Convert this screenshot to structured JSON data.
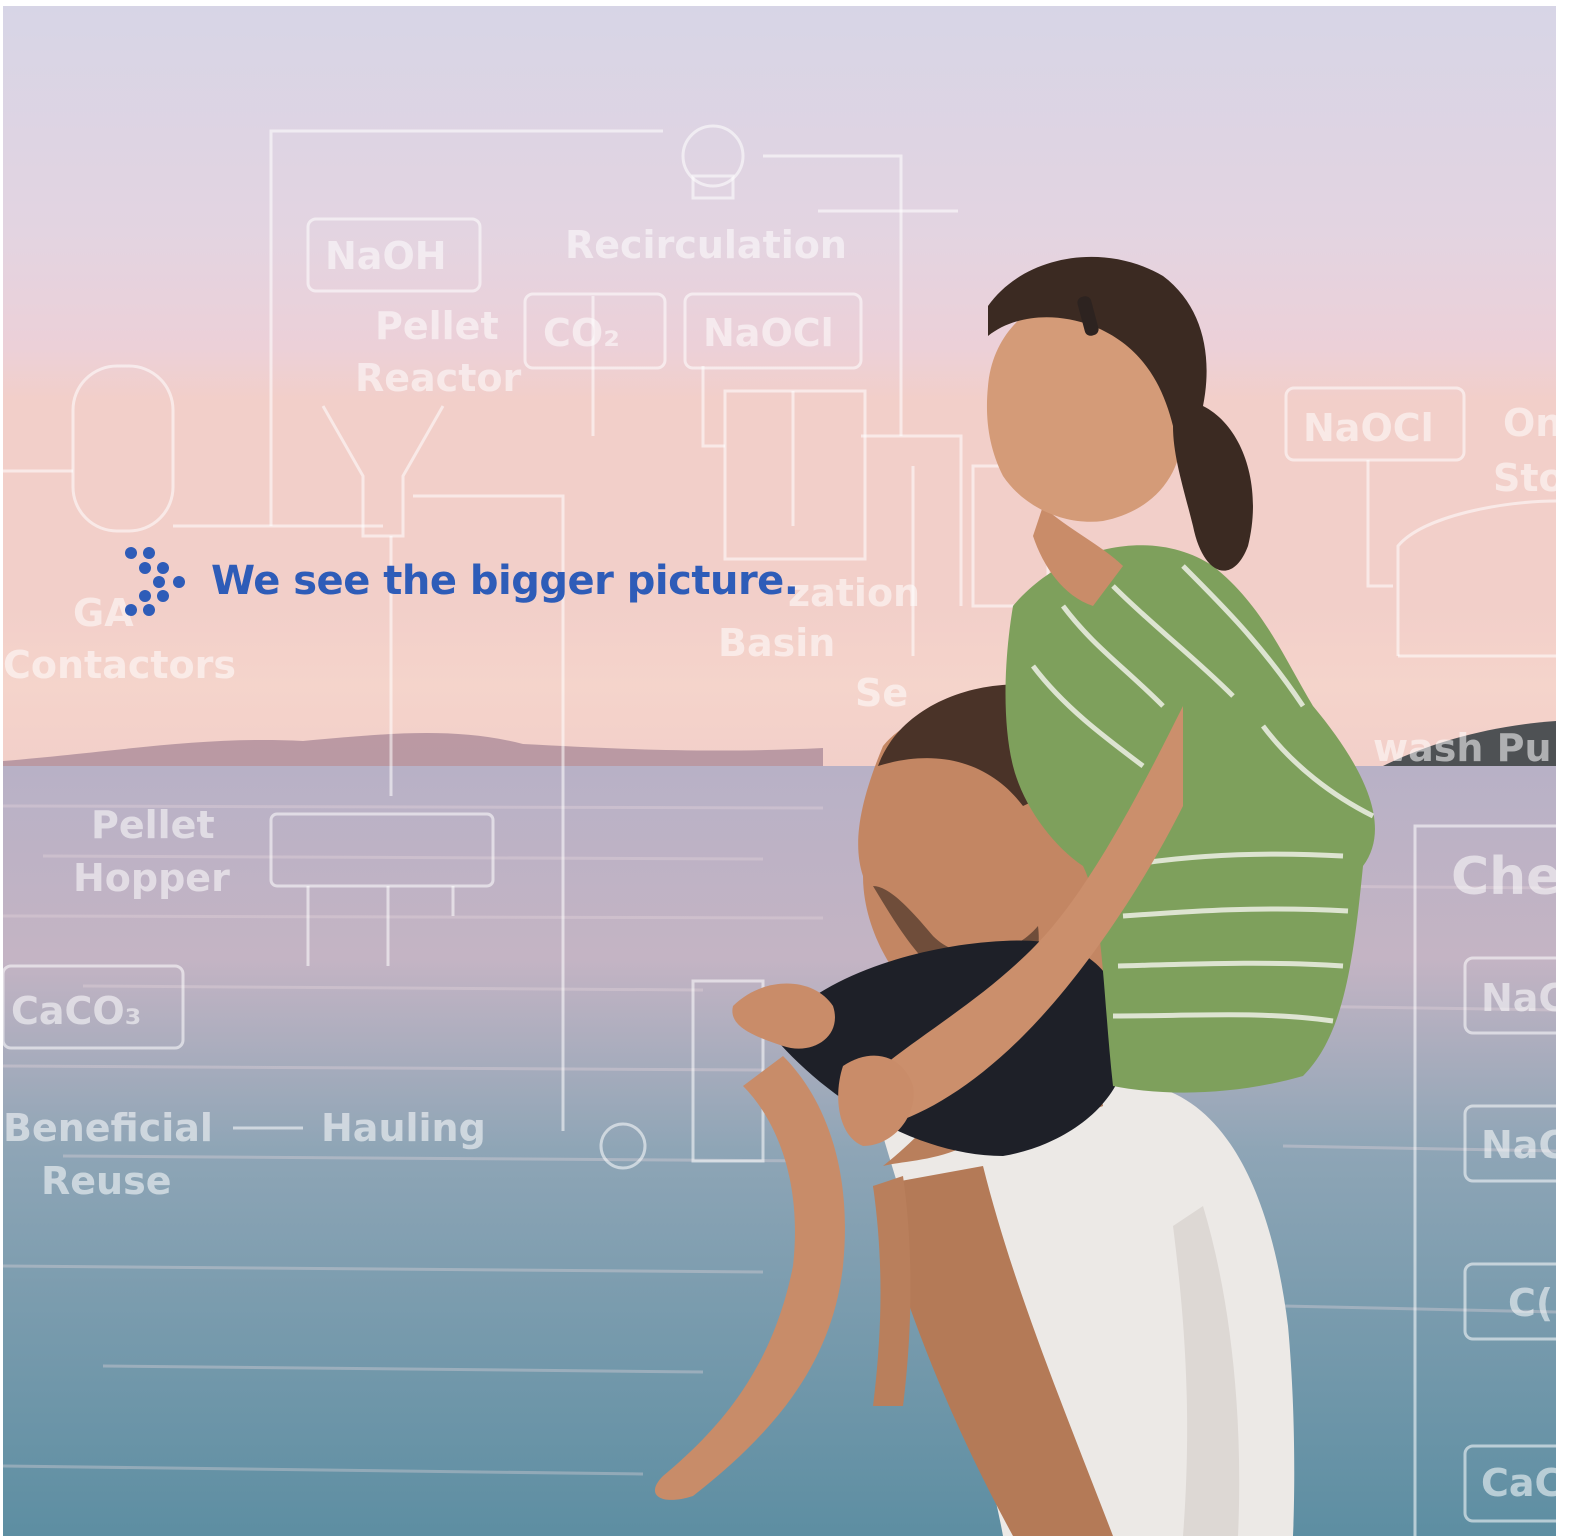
{
  "tagline": {
    "text": "We see the bigger picture.",
    "logo_icon": "dot-chevron-logo-icon",
    "color": "#2e5cb8"
  },
  "diagram": {
    "labels": {
      "naoh": "NaOH",
      "recirculation": "Recirculation",
      "pellet": "Pellet",
      "reactor": "Reactor",
      "co2": "CO₂",
      "naocl_top": "NaOCl",
      "naocl_right": "NaOCl",
      "on_sto_1": "On",
      "on_sto_2": "Sto",
      "gac_1": "GA",
      "gac_2": "Contactors",
      "zation": "zation",
      "basin": "Basin",
      "se": "Se",
      "wash": "wash Pu",
      "pellet_hopper_1": "Pellet",
      "pellet_hopper_2": "Hopper",
      "che": "Che",
      "caco3": "CaCO₃",
      "na_1": "NaC",
      "na_2": "NaC",
      "beneficial": "Beneficial",
      "reuse": "Reuse",
      "hauling": "Hauling",
      "co_right": "C(",
      "caco_right": "CaC"
    }
  },
  "colors": {
    "sky_top": "#d9d6e6",
    "sky_mid": "#e8cfd9",
    "horizon": "#f0c8c0",
    "sea_top": "#a9a6bd",
    "sea_bottom": "#5f8ea3",
    "shirt_green": "#7fa05e",
    "tshirt": "#ece9e6",
    "skin": "#c98e6c",
    "hair": "#3b2a22"
  }
}
